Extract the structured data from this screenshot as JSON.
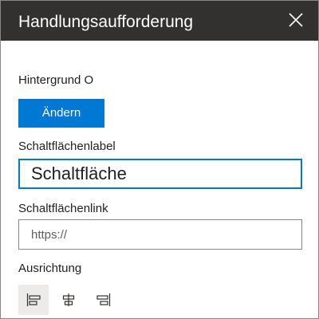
{
  "panel": {
    "title": "Handlungsaufforderung",
    "close_icon": "close-icon"
  },
  "background": {
    "label": "Hintergrund O",
    "change_button": "Ändern"
  },
  "button_label": {
    "label": "Schaltflächenlabel",
    "value": "Schaltfläche"
  },
  "button_link": {
    "label": "Schaltflächenlink",
    "value": "",
    "placeholder": "https://"
  },
  "alignment": {
    "label": "Ausrichtung",
    "options": [
      {
        "icon": "align-left-icon",
        "selected": true
      },
      {
        "icon": "align-center-icon",
        "selected": false
      },
      {
        "icon": "align-right-icon",
        "selected": false
      }
    ]
  },
  "colors": {
    "header_bg": "#323130",
    "accent": "#0078d4",
    "selected_bg": "#edebe9"
  }
}
